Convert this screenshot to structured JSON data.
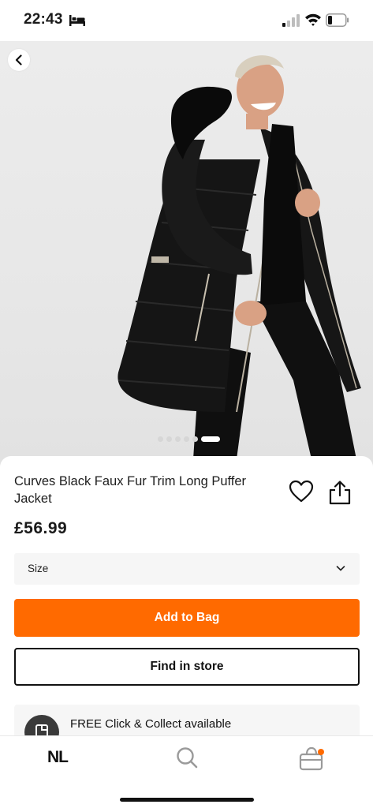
{
  "status_bar": {
    "time": "22:43"
  },
  "hero": {
    "carousel": {
      "count": 6,
      "active_index": 5
    }
  },
  "product": {
    "title": "Curves Black Faux Fur Trim Long Puffer Jacket",
    "price": "£56.99"
  },
  "size_select": {
    "label": "Size"
  },
  "buttons": {
    "add_to_bag": "Add to Bag",
    "find_in_store": "Find in store"
  },
  "delivery": {
    "collect_text": "FREE Click & Collect available"
  },
  "bottom_nav": {
    "logo": "NL"
  },
  "colors": {
    "accent": "#ff6a00",
    "text": "#111111",
    "background": "#ffffff",
    "field_background": "#f6f6f6"
  },
  "icons": [
    "bed-icon",
    "signal-icon",
    "wifi-icon",
    "battery-icon",
    "back-chevron-icon",
    "heart-icon",
    "share-icon",
    "chevron-down-icon",
    "click-collect-icon",
    "search-icon",
    "bag-icon"
  ]
}
